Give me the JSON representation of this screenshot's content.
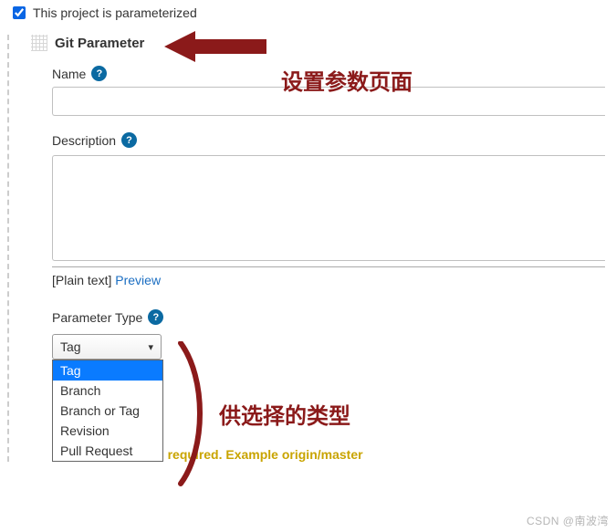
{
  "top": {
    "checked": true,
    "label": "This project is parameterized"
  },
  "block": {
    "title": "Git Parameter",
    "fields": {
      "name_label": "Name",
      "desc_label": "Description",
      "preview_prefix": "[Plain text]",
      "preview_link": "Preview",
      "type_label": "Parameter Type"
    },
    "select": {
      "value": "Tag",
      "options": [
        "Tag",
        "Branch",
        "Branch or Tag",
        "Revision",
        "Pull Request"
      ],
      "highlighted_index": 0
    },
    "warning": "Default value is required. Example origin/master"
  },
  "annotations": {
    "line1": "设置参数页面",
    "line2": "供选择的类型"
  },
  "watermark": "CSDN @南波湾"
}
